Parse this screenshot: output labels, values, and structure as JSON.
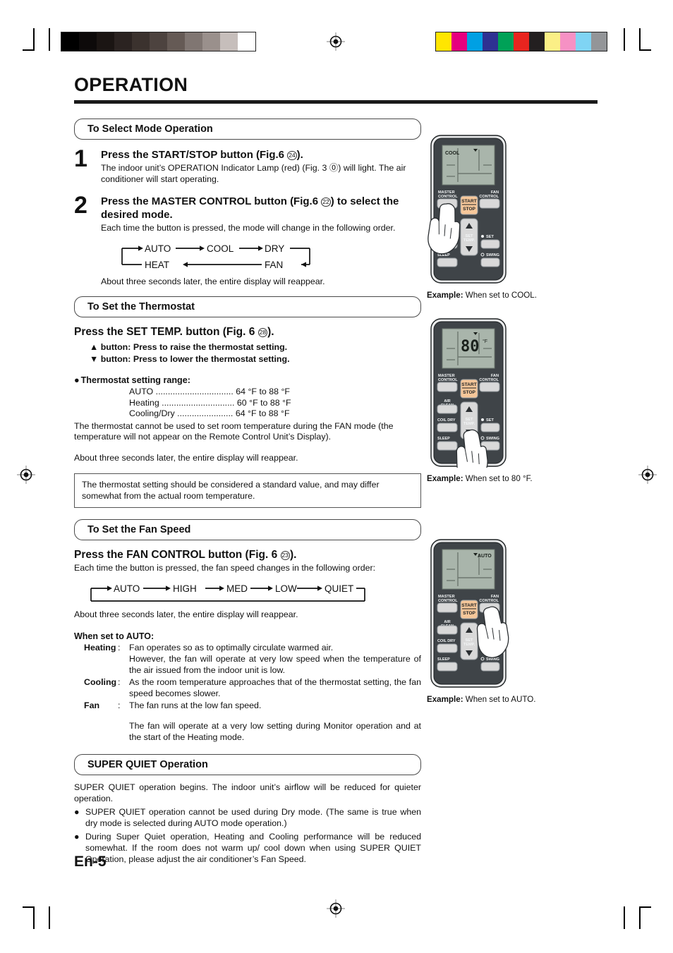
{
  "page": {
    "title": "OPERATION",
    "folio": "En-5"
  },
  "sections": {
    "mode": {
      "heading": "To Select Mode Operation",
      "steps": [
        {
          "num": "1",
          "title_a": "Press the START/STOP button (Fig.6 ",
          "title_ref": "24",
          "title_b": ").",
          "body": "The indoor unit’s OPERATION Indicator Lamp (red) (Fig. 3 ⓪) will light. The air conditioner will start operating."
        },
        {
          "num": "2",
          "title_a": "Press the MASTER CONTROL button (Fig.6 ",
          "title_ref": "22",
          "title_b": ") to select the desired mode.",
          "body": "Each time the button is pressed, the mode will change in the following order.",
          "footer": "About three seconds later, the entire display will reappear."
        }
      ],
      "cycle": [
        "AUTO",
        "COOL",
        "DRY",
        "FAN",
        "HEAT"
      ]
    },
    "thermostat": {
      "heading": "To Set the Thermostat",
      "instruction_a": "Press the SET TEMP. button (Fig. 6 ",
      "instruction_ref": "28",
      "instruction_b": ").",
      "up_button": "button: Press to raise the thermostat setting.",
      "down_button": "button: Press to lower the thermostat setting.",
      "range_title": "Thermostat setting range:",
      "ranges": [
        {
          "mode": "AUTO",
          "dots": "................................",
          "value": "64 °F to 88 °F"
        },
        {
          "mode": "Heating",
          "dots": "..............................",
          "value": "60 °F to 88 °F"
        },
        {
          "mode": "Cooling/Dry",
          "dots": ".......................",
          "value": "64 °F to 88 °F"
        }
      ],
      "fan_note": "The thermostat cannot be used to set room temperature during the FAN mode (the temperature will not appear on the Remote Control Unit’s Display).",
      "delay_note": "About three seconds later, the entire display will reappear.",
      "standard_note": "The thermostat setting should be considered a standard value, and may differ somewhat from the actual room temperature."
    },
    "fan": {
      "heading": "To Set the Fan Speed",
      "instruction_a": "Press the FAN CONTROL button (Fig. 6 ",
      "instruction_ref": "23",
      "instruction_b": ").",
      "body": "Each time the button is pressed, the fan speed changes in the following order:",
      "cycle": [
        "AUTO",
        "HIGH",
        "MED",
        "LOW",
        "QUIET"
      ],
      "footer": "About three seconds later, the entire display will reappear.",
      "auto_head": "When set to AUTO:",
      "auto_rows": [
        {
          "key": "Heating",
          "colon": ":",
          "value": "Fan operates so as to optimally circulate warmed air.\nHowever, the fan will operate at very low speed when the temperature of the air issued from the indoor unit is low."
        },
        {
          "key": "Cooling",
          "colon": ":",
          "value": "As the room temperature approaches that of the thermostat setting, the fan speed becomes slower."
        },
        {
          "key": "Fan",
          "colon": ":",
          "value": "The fan runs at the low fan speed."
        }
      ],
      "auto_tail": "The fan will operate at a very low setting during Monitor operation and at the start of the Heating mode."
    },
    "super_quiet": {
      "heading": "SUPER QUIET Operation",
      "intro": "SUPER QUIET operation begins. The indoor unit’s airflow will be reduced for quieter operation.",
      "items": [
        "SUPER QUIET operation cannot be used during Dry mode. (The same is true when dry mode is selected during AUTO mode operation.)",
        "During Super Quiet operation, Heating and Cooling performance will be reduced somewhat. If the room does not warm up/ cool down when using SUPER QUIET Operation, please adjust the air conditioner’s Fan Speed."
      ]
    }
  },
  "remotes": [
    {
      "display_mode": "COOL",
      "display_temp": "",
      "display_unit": "",
      "caption_label": "Example:",
      "caption_text": " When set to COOL.",
      "pressed": "master-control",
      "buttons": {
        "master_control": "MASTER\nCONTROL",
        "fan_control": "FAN\nCONTROL",
        "start": "START",
        "stop": "STOP",
        "air_clean": "AIR\nCLEAN",
        "coil_dry": "COIL DRY",
        "sleep": "SLEEP",
        "set_temp": "SET\nTEMP.",
        "set": "SET",
        "swing": "SWING"
      }
    },
    {
      "display_mode": "",
      "display_temp": "80",
      "display_unit": "°F",
      "caption_label": "Example:",
      "caption_text": " When set to 80 °F.",
      "pressed": "set-temp-down"
    },
    {
      "display_mode": "AUTO",
      "display_temp": "",
      "display_unit": "",
      "caption_label": "Example:",
      "caption_text": " When set to AUTO.",
      "pressed": "fan-control"
    }
  ],
  "print_marks": {
    "grayscale": [
      "#000000",
      "#0d0a0a",
      "#1b1513",
      "#2b2321",
      "#3b322e",
      "#4d433f",
      "#655a55",
      "#807672",
      "#9a908c",
      "#c6bebb",
      "#ffffff"
    ],
    "colorbar": [
      "#ffe600",
      "#e6007e",
      "#00a0e3",
      "#2e3192",
      "#00a157",
      "#e8251f",
      "#231f20",
      "#fbef86",
      "#f691c4",
      "#7fd4f4",
      "#939598"
    ]
  }
}
